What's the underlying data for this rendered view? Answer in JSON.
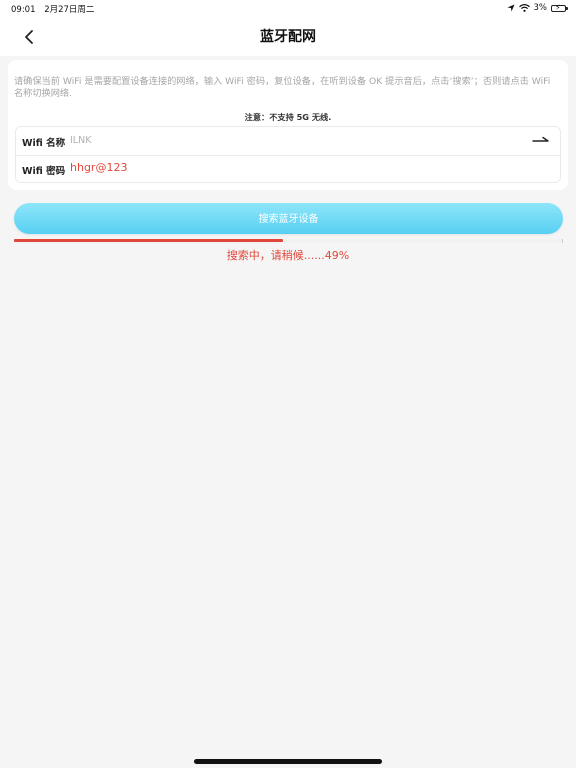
{
  "status_bar": {
    "time": "09:01",
    "date": "2月27日周二",
    "battery_percent": "3%"
  },
  "nav": {
    "title": "蓝牙配网",
    "back_icon": "chevron-left-icon"
  },
  "form": {
    "hint": "请确保当前 WiFi 是需要配置设备连接的网络，输入 WiFi 密码，复位设备，在听到设备 OK 提示音后，点击‘搜索’；否则请点击 WiFi 名称切换网络.",
    "notice": "注意：不支持 5G 无线.",
    "wifi_name_label": "Wifi 名称",
    "wifi_name_value": "ILNK",
    "wifi_password_label": "Wifi 密码",
    "wifi_password_value": "hhgr@123"
  },
  "search": {
    "button_label": "搜索蓝牙设备",
    "progress_fraction": 0.49,
    "progress_text": "搜索中，请稍候......49%"
  },
  "colors": {
    "accent": "#5ad0f3",
    "error_red": "#e0473a"
  }
}
